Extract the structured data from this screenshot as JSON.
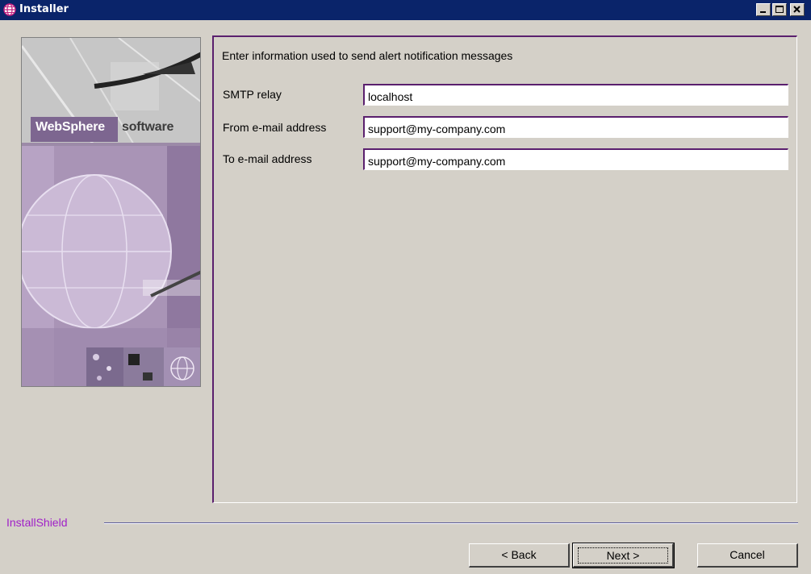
{
  "window": {
    "title": "Installer",
    "controls": {
      "minimize": "minimize-icon",
      "maximize": "maximize-icon",
      "close": "close-icon"
    }
  },
  "banner": {
    "brand": "WebSphere",
    "product": "software"
  },
  "panel": {
    "heading": "Enter information used to send alert notification messages",
    "fields": [
      {
        "label": "SMTP relay",
        "value": "localhost"
      },
      {
        "label": "From e-mail address",
        "value": "support@my-company.com"
      },
      {
        "label": "To e-mail address",
        "value": "support@my-company.com"
      }
    ]
  },
  "footer": {
    "installshield_label": "InstallShield"
  },
  "buttons": {
    "back": "< Back",
    "next": "Next >",
    "cancel": "Cancel"
  },
  "colors": {
    "titlebar": "#0a246a",
    "accent": "#5a1f6e",
    "installshield": "#a020c8",
    "background": "#d4d0c8"
  }
}
